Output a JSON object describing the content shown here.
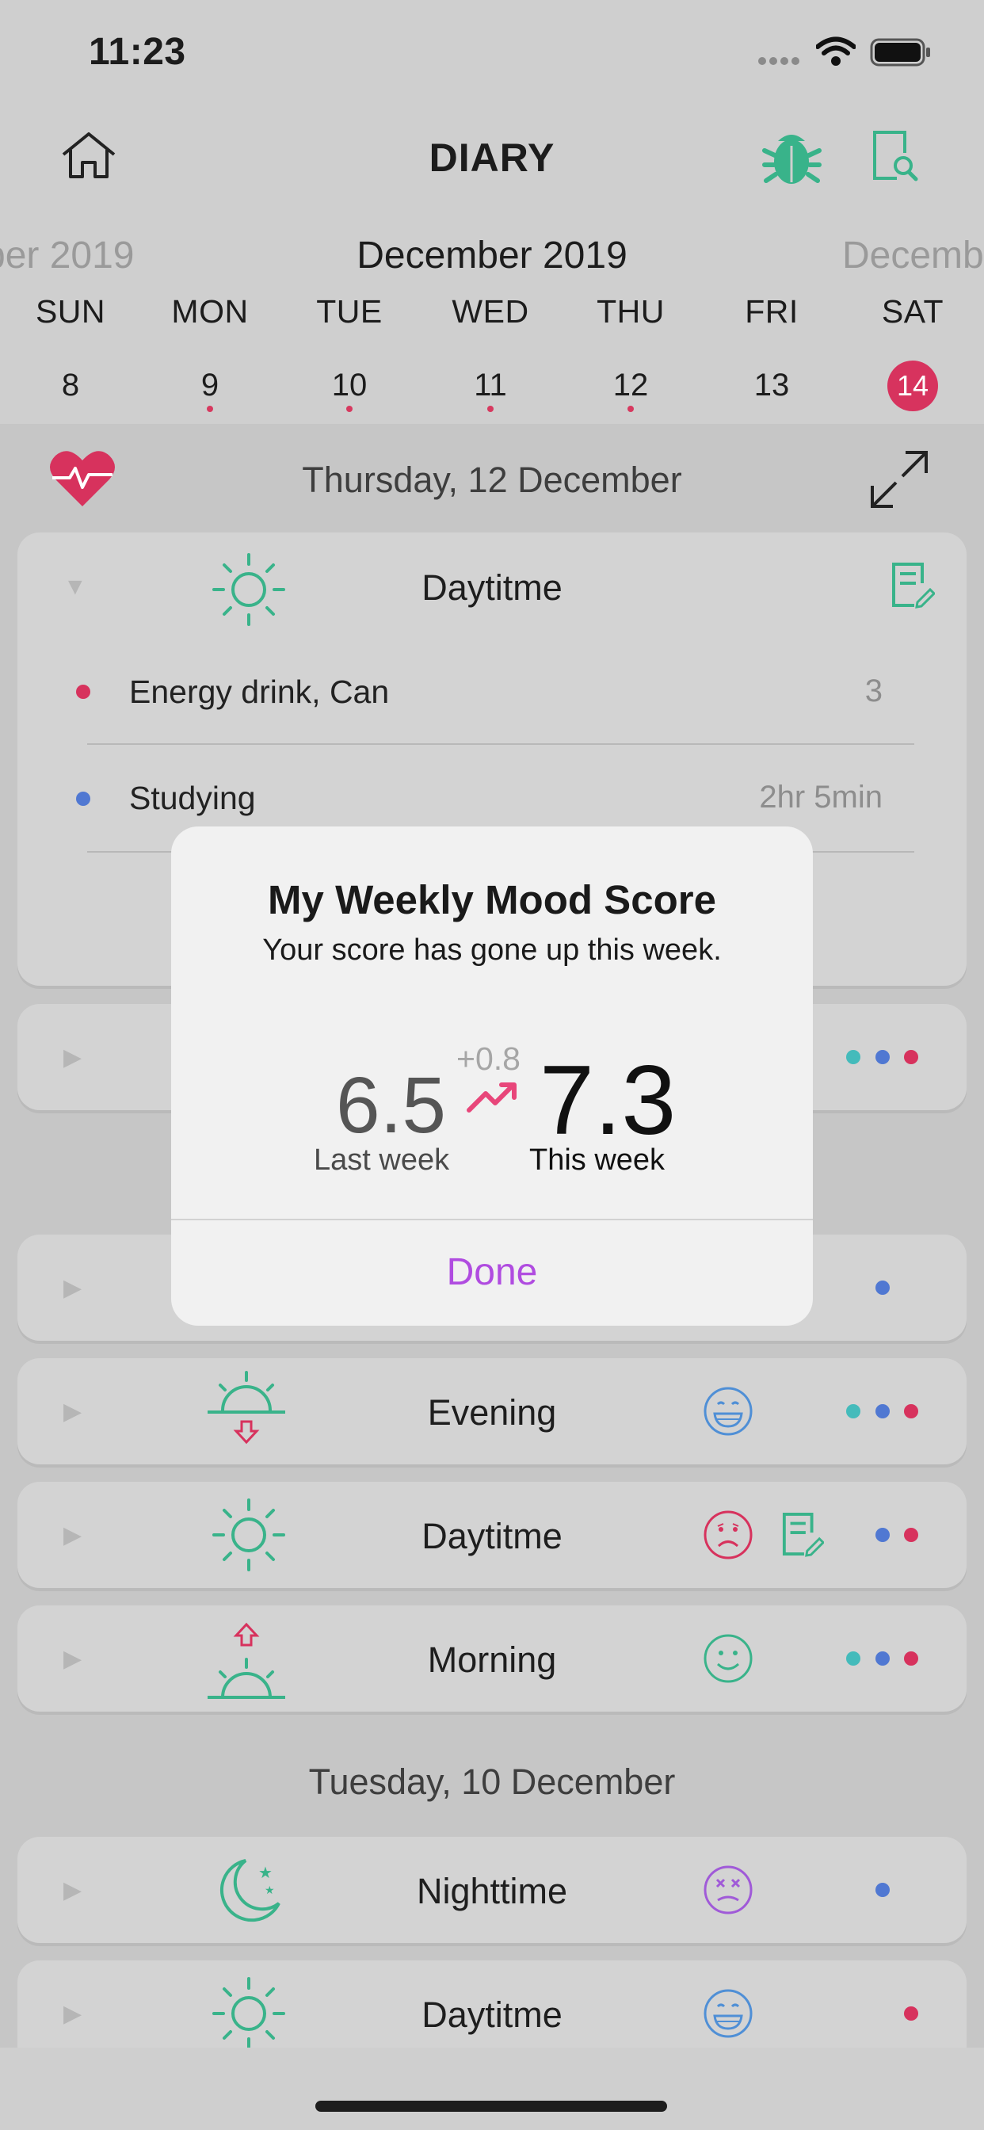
{
  "status": {
    "time": "11:23"
  },
  "header": {
    "title": "DIARY",
    "home_icon": "home-icon",
    "bug_icon": "bug-icon",
    "report_icon": "report-search-icon"
  },
  "calendar": {
    "prev_month": "ber 2019",
    "current_month": "December 2019",
    "next_month": "Decemb",
    "days": [
      {
        "name": "SUN",
        "date": "8",
        "dot": false,
        "selected": false
      },
      {
        "name": "MON",
        "date": "9",
        "dot": true,
        "selected": false
      },
      {
        "name": "TUE",
        "date": "10",
        "dot": true,
        "selected": false
      },
      {
        "name": "WED",
        "date": "11",
        "dot": true,
        "selected": false
      },
      {
        "name": "THU",
        "date": "12",
        "dot": true,
        "selected": false
      },
      {
        "name": "FRI",
        "date": "13",
        "dot": false,
        "selected": false
      },
      {
        "name": "SAT",
        "date": "14",
        "dot": false,
        "selected": true
      }
    ]
  },
  "section1": {
    "date": "Thursday, 12 December",
    "expanded_card": {
      "label": "Daytitme",
      "entries": [
        {
          "name": "Energy drink, Can",
          "value": "3",
          "color": "#d7325d"
        },
        {
          "name": "Studying",
          "value": "2hr 5min",
          "color": "#5078d2"
        }
      ]
    },
    "cards": [
      {
        "label": "Evening"
      },
      {
        "label": "Daytitme"
      },
      {
        "label": "Morning"
      }
    ]
  },
  "section2": {
    "date": "Tuesday, 10 December",
    "cards": [
      {
        "label": "Nighttime"
      },
      {
        "label": "Daytitme"
      }
    ]
  },
  "dialog": {
    "title": "My Weekly Mood Score",
    "subtitle": "Your score has gone up this week.",
    "last_week_score": "6.5",
    "last_week_label": "Last week",
    "this_week_score": "7.3",
    "this_week_label": "This week",
    "delta": "+0.8",
    "done_label": "Done"
  },
  "colors": {
    "accent_green": "#39b38a",
    "accent_red": "#d7325d",
    "accent_blue": "#4f8fd6",
    "accent_purple": "#a05ad8",
    "done_color": "#b04ce0"
  }
}
